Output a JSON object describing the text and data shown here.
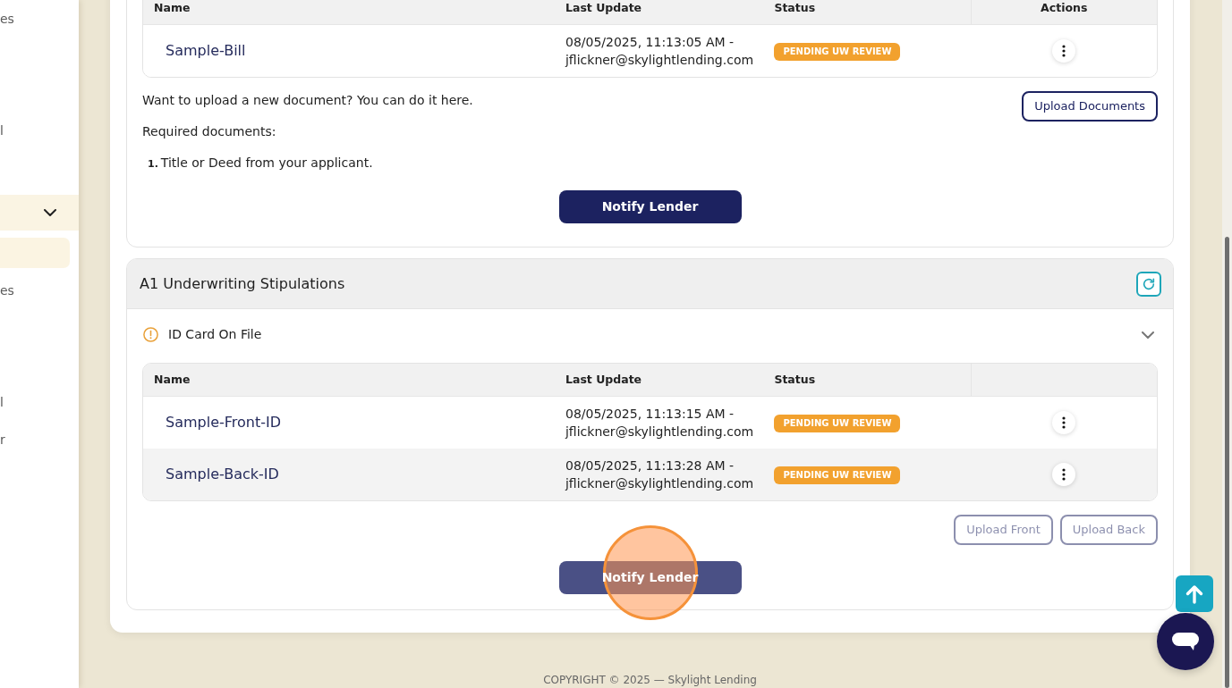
{
  "sidebar": {
    "items": [
      {
        "kind": "link",
        "label": "es",
        "selected": false
      },
      {
        "kind": "link",
        "label": "l",
        "selected": false
      },
      {
        "kind": "group",
        "expanded": true
      },
      {
        "kind": "link",
        "selected": true
      },
      {
        "kind": "link",
        "label": "es",
        "selected": false
      },
      {
        "kind": "link",
        "label": "l",
        "selected": false
      },
      {
        "kind": "link",
        "label": "r",
        "selected": false
      }
    ]
  },
  "sections": [
    {
      "table": {
        "columns": [
          "Name",
          "Last Update",
          "Status",
          "Actions"
        ],
        "rows": [
          {
            "name": "Sample-Bill",
            "last_update": "08/05/2025, 11:13:05 AM - jflickner@skylightlending.com",
            "status": "PENDING UW REVIEW"
          }
        ]
      },
      "upload_note": "Want to upload a new document? You can do it here.",
      "upload_buttons": [
        {
          "label": "Upload Documents",
          "disabled": false
        }
      ],
      "required_title": "Required documents:",
      "required_documents": [
        {
          "number": "1.",
          "text": "Title or Deed from your applicant."
        }
      ],
      "notify_button": {
        "label": "Notify Lender",
        "hovered": false,
        "click_marker": false
      }
    },
    {
      "title": "A1 Underwriting Stipulations",
      "items": [
        {
          "label": "ID Card On File",
          "expanded": true,
          "table": {
            "columns": [
              "Name",
              "Last Update",
              "Status"
            ],
            "rows": [
              {
                "name": "Sample-Front-ID",
                "last_update": "08/05/2025, 11:13:15 AM - jflickner@skylightlending.com",
                "status": "PENDING UW REVIEW"
              },
              {
                "name": "Sample-Back-ID",
                "last_update": "08/05/2025, 11:13:28 AM - jflickner@skylightlending.com",
                "status": "PENDING UW REVIEW"
              }
            ]
          },
          "upload_buttons": [
            {
              "label": "Upload Front",
              "disabled": true
            },
            {
              "label": "Upload Back",
              "disabled": true
            }
          ]
        }
      ],
      "notify_button": {
        "label": "Notify Lender",
        "hovered": true,
        "click_marker": true
      }
    }
  ],
  "footer": {
    "text": "COPYRIGHT © 2025 — Skylight Lending"
  },
  "floating_buttons": [
    {
      "kind": "scroll_top"
    },
    {
      "kind": "chat"
    }
  ]
}
